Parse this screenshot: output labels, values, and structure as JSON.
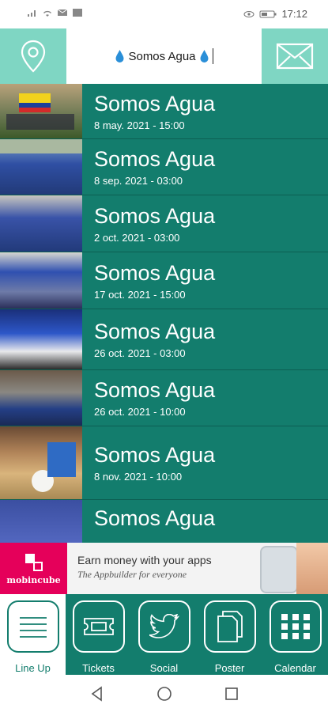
{
  "status_bar": {
    "time": "17:12"
  },
  "header": {
    "title": "Somos Agua"
  },
  "events": [
    {
      "title": "Somos Agua",
      "date": "8 may. 2021 - 15:00"
    },
    {
      "title": "Somos Agua",
      "date": "8 sep. 2021 - 03:00"
    },
    {
      "title": "Somos Agua",
      "date": "2 oct. 2021 - 03:00"
    },
    {
      "title": "Somos Agua",
      "date": "17 oct. 2021 - 15:00"
    },
    {
      "title": "Somos Agua",
      "date": "26 oct. 2021 - 03:00"
    },
    {
      "title": "Somos Agua",
      "date": "26 oct. 2021 - 10:00"
    },
    {
      "title": "Somos Agua",
      "date": "8 nov. 2021 - 10:00"
    },
    {
      "title": "Somos Agua",
      "date": ""
    }
  ],
  "ad": {
    "logo_text": "mobincube",
    "headline": "Earn money with your apps",
    "subline": "The Appbuilder for everyone"
  },
  "tabs": [
    {
      "label": "Line Up",
      "icon": "list-icon",
      "active": true
    },
    {
      "label": "Tickets",
      "icon": "ticket-icon",
      "active": false
    },
    {
      "label": "Social",
      "icon": "twitter-icon",
      "active": false
    },
    {
      "label": "Poster",
      "icon": "documents-icon",
      "active": false
    },
    {
      "label": "Calendar",
      "icon": "grid-icon",
      "active": false
    }
  ],
  "colors": {
    "primary": "#137d6d",
    "header_button": "#7fd6c3",
    "drop": "#2a8fd8",
    "ad_logo": "#e5005a"
  }
}
